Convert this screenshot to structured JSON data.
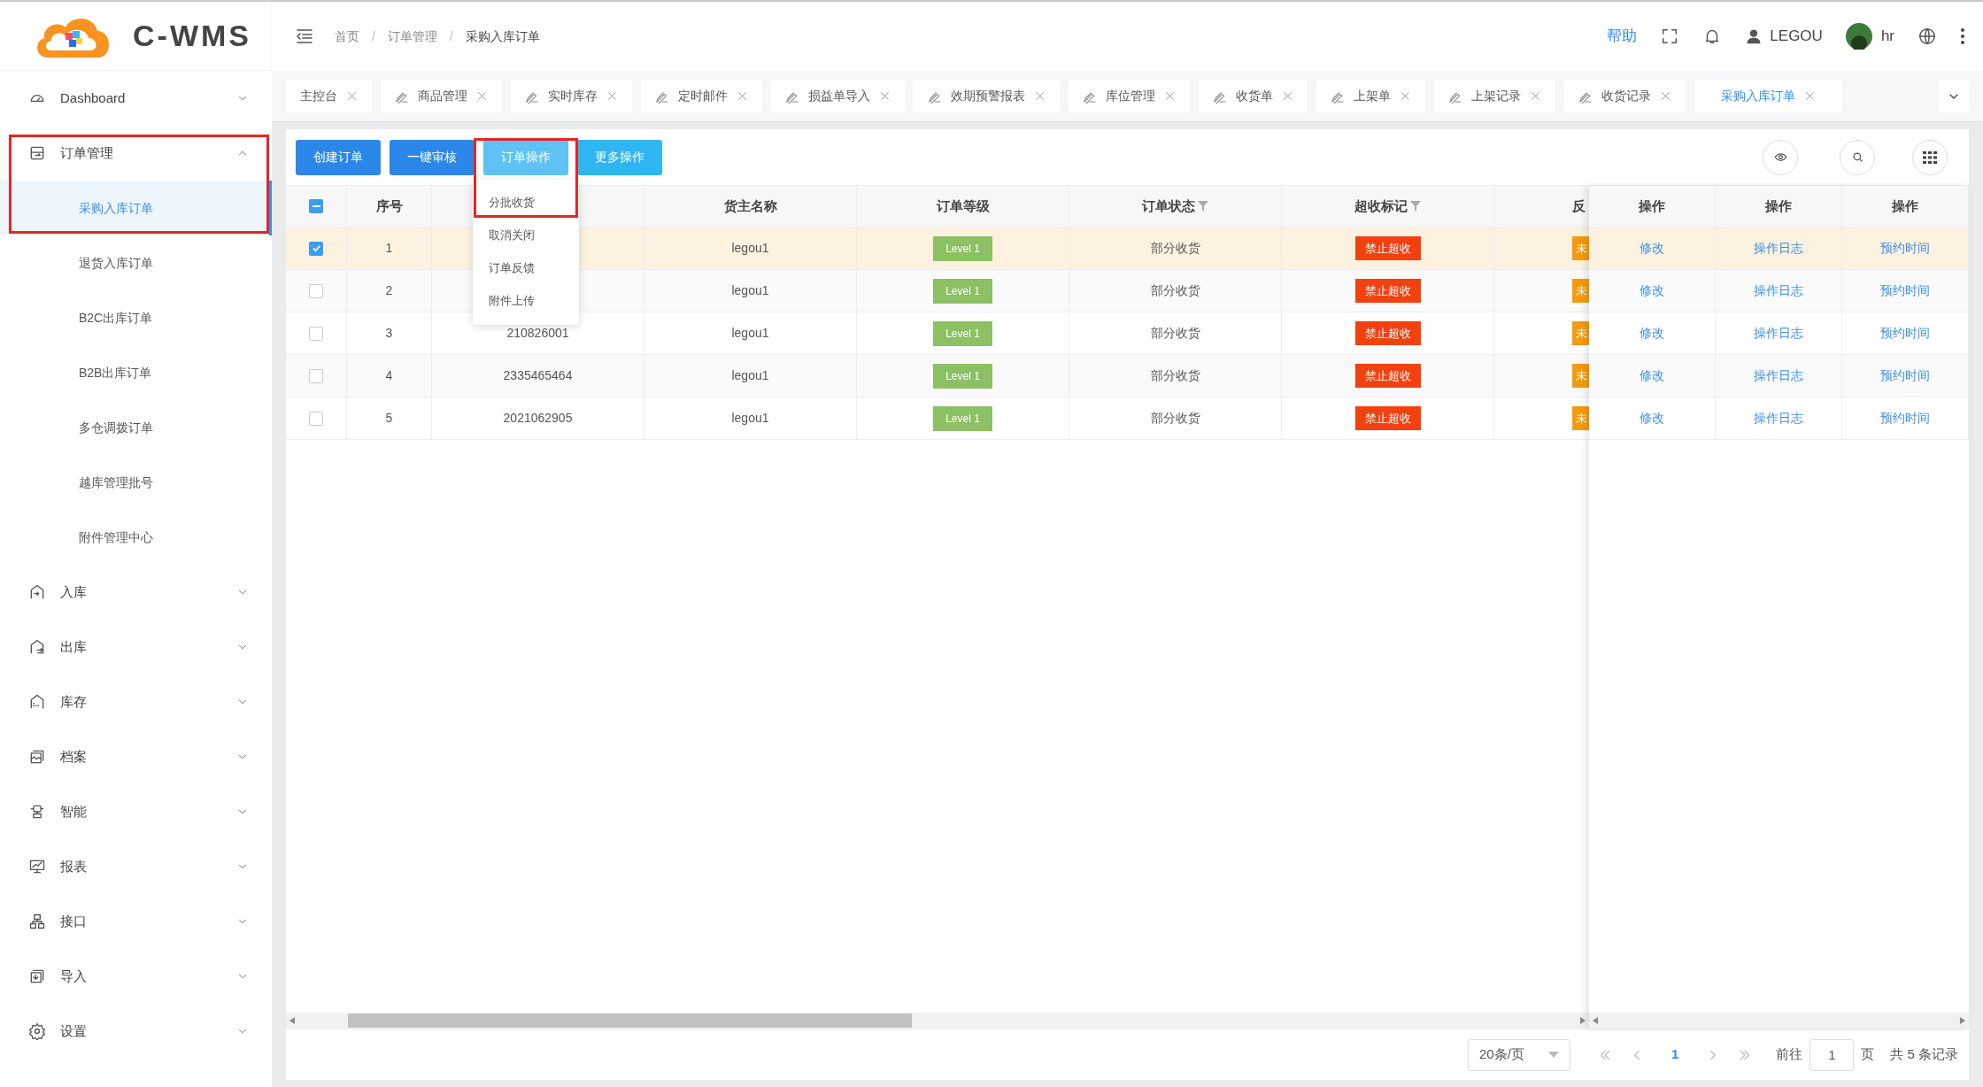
{
  "logo_text": "C-WMS",
  "header": {
    "breadcrumb": [
      "首页",
      "订单管理",
      "采购入库订单"
    ],
    "separator": "/",
    "help": "帮助",
    "user": "LEGOU",
    "account": "hr"
  },
  "sidebar": [
    {
      "label": "Dashboard",
      "expanded": false
    },
    {
      "label": "订单管理",
      "expanded": true,
      "highlighted": true,
      "children": [
        {
          "label": "采购入库订单",
          "selected": true
        },
        {
          "label": "退货入库订单",
          "selected": false
        },
        {
          "label": "B2C出库订单",
          "selected": false
        },
        {
          "label": "B2B出库订单",
          "selected": false
        },
        {
          "label": "多仓调拨订单",
          "selected": false
        },
        {
          "label": "越库管理批号",
          "selected": false
        },
        {
          "label": "附件管理中心",
          "selected": false
        }
      ]
    },
    {
      "label": "入库",
      "expanded": false
    },
    {
      "label": "出库",
      "expanded": false
    },
    {
      "label": "库存",
      "expanded": false
    },
    {
      "label": "档案",
      "expanded": false
    },
    {
      "label": "智能",
      "expanded": false
    },
    {
      "label": "报表",
      "expanded": false
    },
    {
      "label": "接口",
      "expanded": false
    },
    {
      "label": "导入",
      "expanded": false
    },
    {
      "label": "设置",
      "expanded": false
    }
  ],
  "tabs": [
    {
      "label": "主控台",
      "kind": "plain",
      "selected": false
    },
    {
      "label": "商品管理",
      "kind": "page",
      "selected": false
    },
    {
      "label": "实时库存",
      "kind": "page",
      "selected": false
    },
    {
      "label": "定时邮件",
      "kind": "page",
      "selected": false
    },
    {
      "label": "损益单导入",
      "kind": "page",
      "selected": false
    },
    {
      "label": "效期预警报表",
      "kind": "page",
      "selected": false
    },
    {
      "label": "库位管理",
      "kind": "page",
      "selected": false
    },
    {
      "label": "收货单",
      "kind": "page",
      "selected": false
    },
    {
      "label": "上架单",
      "kind": "page",
      "selected": false
    },
    {
      "label": "上架记录",
      "kind": "page",
      "selected": false
    },
    {
      "label": "收货记录",
      "kind": "page",
      "selected": false
    },
    {
      "label": "采购入库订单",
      "kind": "plain",
      "selected": true
    }
  ],
  "toolbar": [
    {
      "label": "创建订单",
      "kind": "primary"
    },
    {
      "label": "一键审核",
      "kind": "primary"
    },
    {
      "label": "订单操作",
      "kind": "menu"
    },
    {
      "label": "更多操作",
      "kind": "secondary"
    }
  ],
  "dropdown": {
    "highlighted": true,
    "items": [
      {
        "label": "分批收货"
      },
      {
        "label": "取消关闭"
      },
      {
        "label": "订单反馈"
      },
      {
        "label": "附件上传"
      }
    ]
  },
  "table": {
    "header_checkbox": {
      "indeterminate": true
    },
    "columns": [
      {
        "kind": "text",
        "label": "序号"
      },
      {
        "kind": "covered"
      },
      {
        "kind": "text",
        "label": "货主名称"
      },
      {
        "kind": "text",
        "label": "订单等级"
      },
      {
        "kind": "filter",
        "label": "订单状态"
      },
      {
        "kind": "filter",
        "label": "超收标记"
      },
      {
        "kind": "cut",
        "label": "反"
      }
    ],
    "fixed_columns": [
      "操作",
      "操作",
      "操作"
    ],
    "rows": [
      {
        "checked": true,
        "index": "1",
        "owner": "legou1",
        "level": "Level 1",
        "status": "部分收货",
        "overflow": "禁止超收",
        "column_8": "未",
        "actions": [
          "修改",
          "操作日志",
          "预约时间"
        ]
      },
      {
        "checked": false,
        "index": "2",
        "owner": "legou1",
        "level": "Level 1",
        "status": "部分收货",
        "overflow": "禁止超收",
        "column_8": "未",
        "actions": [
          "修改",
          "操作日志",
          "预约时间"
        ]
      },
      {
        "checked": false,
        "index": "3",
        "order_no": "210826001",
        "owner": "legou1",
        "level": "Level 1",
        "status": "部分收货",
        "overflow": "禁止超收",
        "column_8": "未",
        "actions": [
          "修改",
          "操作日志",
          "预约时间"
        ]
      },
      {
        "checked": false,
        "index": "4",
        "order_no": "2335465464",
        "owner": "legou1",
        "level": "Level 1",
        "status": "部分收货",
        "overflow": "禁止超收",
        "column_8": "未",
        "actions": [
          "修改",
          "操作日志",
          "预约时间"
        ]
      },
      {
        "checked": false,
        "index": "5",
        "order_no": "2021062905",
        "owner": "legou1",
        "level": "Level 1",
        "status": "部分收货",
        "overflow": "禁止超收",
        "column_8": "未",
        "actions": [
          "修改",
          "操作日志",
          "预约时间"
        ]
      }
    ]
  },
  "pagination": {
    "page_size": "20条/页",
    "pages": [
      {
        "label": "1",
        "selected": true
      }
    ],
    "goto_label": "前往",
    "goto_value": "1",
    "page_unit": "页",
    "total": "共 5 条记录"
  }
}
